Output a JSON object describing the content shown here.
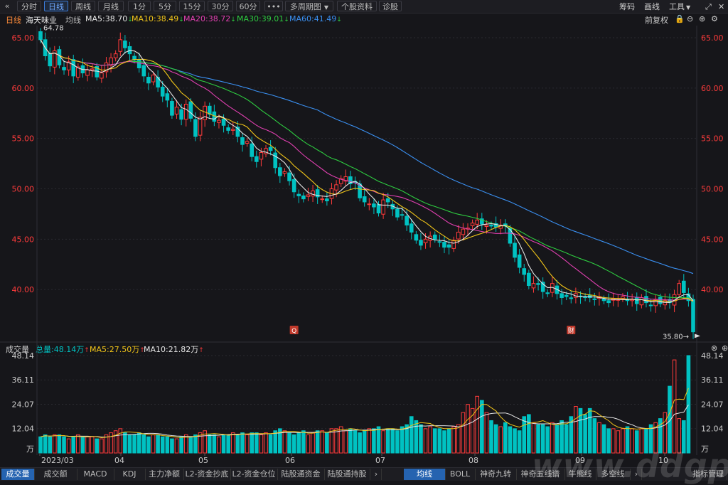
{
  "toolbar": {
    "back_icon": "«",
    "periods": [
      "分时",
      "日线",
      "周线",
      "月线",
      "1分",
      "5分",
      "15分",
      "30分",
      "60分"
    ],
    "active_period": "日线",
    "more_label": "•••",
    "multi_period_label": "多周期图",
    "profile_label": "个股资料",
    "diagnose_label": "诊股",
    "chip_label": "筹码",
    "draw_label": "画线",
    "tools_label": "工具"
  },
  "info": {
    "period": "日线",
    "stock_name": "海天味业",
    "ma_label": "均线",
    "ma5": "MA5:38.70",
    "ma10": "MA10:38.49",
    "ma20": "MA20:38.72",
    "ma30": "MA30:39.01",
    "ma60": "MA60:41.49",
    "adjust_label": "前复权"
  },
  "volume_info": {
    "title": "成交量",
    "total": "总量:48.14万",
    "ma5": "MA5:27.50万",
    "ma10": "MA10:21.82万"
  },
  "tabs_left": [
    "成交量",
    "成交额",
    "MACD",
    "KDJ",
    "主力净额",
    "L2-资金抄底",
    "L2-资金仓位",
    "陆股通资金",
    "陆股通持股"
  ],
  "tabs_right": [
    "均线",
    "BOLL",
    "神奇九转",
    "神奇五线谱",
    "牛熊线",
    "多空线"
  ],
  "tab_right_label": "指标管理",
  "watermark": "www.ddgp.net",
  "colors": {
    "up": "#ff3b3b",
    "down": "#00c2c2",
    "ma5": "#e6e6e6",
    "ma10": "#f0c419",
    "ma20": "#e040b0",
    "ma30": "#2ecc40",
    "ma60": "#3a8ff0"
  },
  "chart_data": {
    "type": "candlestick",
    "price_axis_labels": [
      "65.00",
      "60.00",
      "55.00",
      "50.00",
      "45.00",
      "40.00"
    ],
    "price_ticks": [
      65,
      60,
      55,
      50,
      45,
      40
    ],
    "price_range": [
      35.0,
      66.2
    ],
    "x_labels": [
      "2023/03",
      "04",
      "05",
      "06",
      "07",
      "08",
      "09",
      "10"
    ],
    "max_marker": "64.78",
    "min_marker": "35.80",
    "markers": [
      "Q",
      "财"
    ],
    "closes": [
      64.8,
      63.2,
      62.2,
      63.7,
      62.3,
      61.8,
      62.6,
      61.2,
      62.1,
      61.5,
      61.8,
      61.9,
      61.1,
      61.5,
      62.5,
      63.0,
      63.4,
      64.8,
      64.0,
      63.4,
      62.8,
      62.0,
      61.2,
      60.5,
      61.3,
      60.1,
      59.2,
      58.8,
      57.3,
      58.1,
      56.9,
      58.4,
      57.0,
      55.2,
      57.1,
      58.2,
      57.4,
      56.7,
      56.8,
      56.3,
      55.8,
      55.9,
      55.2,
      54.4,
      54.7,
      53.2,
      52.7,
      53.6,
      54.0,
      53.8,
      52.1,
      51.3,
      51.7,
      50.8,
      49.7,
      49.3,
      49.0,
      49.4,
      49.8,
      49.2,
      49.0,
      48.8,
      50.0,
      50.4,
      51.0,
      51.2,
      50.5,
      50.6,
      49.1,
      48.7,
      48.5,
      48.2,
      47.6,
      48.9,
      48.7,
      48.0,
      47.2,
      47.4,
      46.4,
      45.7,
      44.9,
      44.4,
      45.0,
      45.3,
      45.0,
      44.7,
      44.2,
      44.2,
      44.9,
      45.7,
      46.0,
      46.1,
      46.6,
      46.9,
      46.5,
      46.4,
      46.3,
      46.2,
      46.4,
      46.3,
      44.6,
      43.2,
      42.2,
      41.5,
      40.4,
      40.6,
      40.5,
      39.8,
      39.6,
      40.6,
      39.6,
      39.2,
      39.3,
      39.1,
      39.6,
      39.3,
      39.2,
      39.2,
      39.0,
      39.3,
      38.9,
      38.7,
      39.1,
      39.0,
      39.3,
      38.9,
      39.0,
      38.6,
      39.2,
      38.7,
      38.4,
      39.0,
      38.6,
      38.9,
      38.7,
      39.5,
      40.6,
      39.7,
      38.9,
      35.8
    ],
    "volume_axis_labels": [
      "48.14",
      "36.11",
      "24.07",
      "12.04"
    ],
    "volume_unit": "万",
    "volume_ticks": [
      48.14,
      36.11,
      24.07,
      12.04
    ],
    "volumes": [
      8,
      9,
      8,
      9,
      9,
      8,
      7,
      8,
      9,
      8,
      8,
      8,
      7,
      7,
      9,
      10,
      11,
      12,
      10,
      9,
      9,
      10,
      9,
      8,
      9,
      9,
      8,
      8,
      7,
      7,
      8,
      9,
      8,
      9,
      10,
      11,
      9,
      9,
      8,
      9,
      9,
      10,
      9,
      10,
      9,
      10,
      10,
      9,
      10,
      9,
      11,
      12,
      11,
      10,
      9,
      10,
      11,
      9,
      10,
      11,
      11,
      10,
      12,
      12,
      13,
      11,
      12,
      11,
      10,
      11,
      12,
      12,
      13,
      11,
      12,
      12,
      11,
      13,
      14,
      18,
      16,
      14,
      12,
      13,
      12,
      12,
      11,
      12,
      13,
      14,
      20,
      24,
      22,
      28,
      26,
      20,
      16,
      14,
      13,
      15,
      13,
      12,
      11,
      18,
      19,
      15,
      14,
      14,
      13,
      15,
      14,
      16,
      14,
      18,
      23,
      22,
      19,
      22,
      17,
      15,
      14,
      12,
      12,
      11,
      12,
      13,
      12,
      11,
      12,
      12,
      14,
      15,
      17,
      20,
      33,
      46,
      17,
      16,
      48.14
    ]
  }
}
